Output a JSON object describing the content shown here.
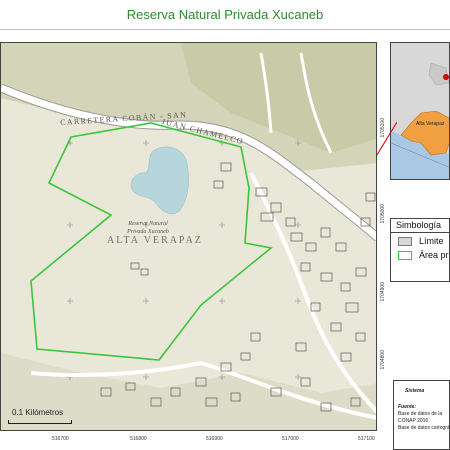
{
  "title": "Reserva Natural Privada Xucaneb",
  "colors": {
    "title": "#2e8b2e",
    "reserve_boundary": "#39c639",
    "terrain": "#e9e7d7",
    "lagoon": "#b7d5dc",
    "inset_water": "#a9c8e6",
    "inset_department": "#f0a040"
  },
  "map": {
    "ticks_top": [
      "516700",
      "516800",
      "516900",
      "517000",
      "517100"
    ],
    "ticks_bottom": [
      "516700",
      "516800",
      "516900",
      "517000",
      "517100"
    ],
    "ticks_right": [
      "1705100",
      "1705000",
      "1704900",
      "1704800"
    ],
    "road_label_1": "CARRETERA COBÁN - SAN",
    "road_label_2": "JUAN CHAMELCO",
    "region_label": "ALTA VERAPAZ",
    "reserve_label": "Reserva Natural Privada Xucaneb",
    "scale_label": "0.1 Kilómetros"
  },
  "inset": {
    "label": "Alta Verapaz"
  },
  "legend": {
    "title": "Simbología",
    "items": [
      {
        "label": "Límite",
        "icon": "gray-fill-swatch"
      },
      {
        "label": "Área pr",
        "icon": "green-outline-swatch"
      }
    ]
  },
  "info": {
    "heading": "Sistema",
    "fuente": "Fuente:",
    "line1": "Base de datos de la",
    "line2": "CONAP 2016",
    "line3": "Base de datos cartográ"
  }
}
